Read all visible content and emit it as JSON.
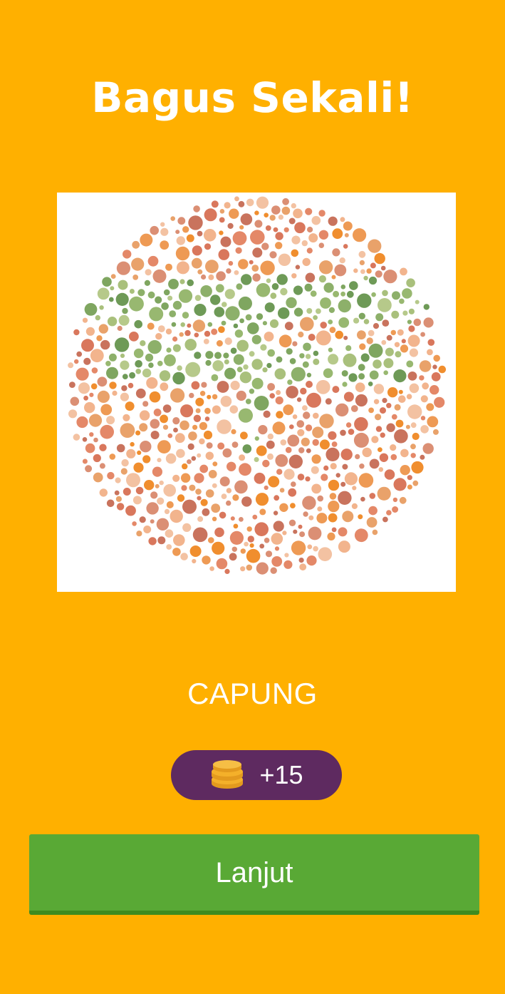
{
  "title": "Bagus Sekali!",
  "plate": {
    "description": "Ishihara color-vision test plate",
    "hidden_figure": "dragonfly"
  },
  "answer": "CAPUNG",
  "reward": {
    "icon": "coin-stack-icon",
    "text": "+15"
  },
  "next_button": {
    "label": "Lanjut"
  },
  "colors": {
    "background": "#FFB000",
    "pill": "#5E2A60",
    "button": "#59A935",
    "button_shadow": "#3E8B1F",
    "coin": "#F4B02A",
    "text": "#FFFFFF"
  }
}
